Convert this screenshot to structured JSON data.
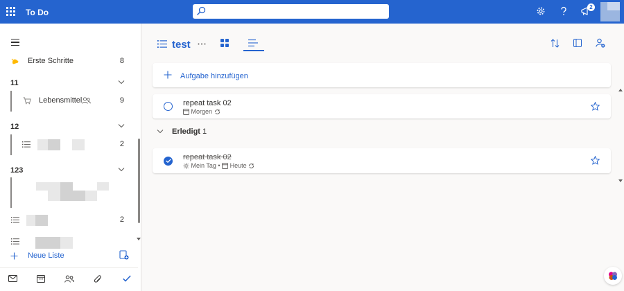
{
  "header": {
    "app_title": "To Do",
    "search_value": "",
    "notification_count": "2"
  },
  "sidebar": {
    "items": {
      "getting_started": {
        "label": "Erste Schritte",
        "count": "8"
      }
    },
    "groups": [
      {
        "label": "11",
        "lists": [
          {
            "label": "Lebensmittel",
            "count": "9"
          }
        ]
      },
      {
        "label": "12",
        "lists": [
          {
            "count": "2"
          }
        ]
      },
      {
        "label": "123"
      }
    ],
    "ungrouped": [
      {
        "count": "2"
      }
    ],
    "new_list_label": "Neue Liste"
  },
  "main": {
    "list_title": "test",
    "add_task_label": "Aufgabe hinzufügen",
    "tasks": [
      {
        "title": "repeat task 02",
        "due": "Morgen",
        "completed": false
      }
    ],
    "completed_section": {
      "label": "Erledigt",
      "count": "1",
      "tasks": [
        {
          "title": "repeat task 02",
          "my_day": "Mein Tag",
          "separator": "•",
          "due": "Heute",
          "completed": true
        }
      ]
    }
  },
  "colors": {
    "accent": "#2564cf",
    "background": "#faf9f8",
    "text": "#323130"
  }
}
